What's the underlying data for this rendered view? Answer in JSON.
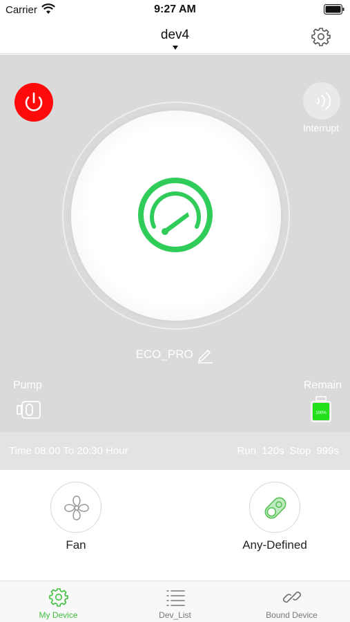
{
  "status_bar": {
    "carrier": "Carrier",
    "time": "9:27 AM"
  },
  "header": {
    "device_name": "dev4"
  },
  "controls": {
    "interrupt_label": "Interrupt"
  },
  "mode": {
    "name": "ECO_PRO"
  },
  "pump": {
    "label": "Pump"
  },
  "remain": {
    "label": "Remain",
    "level_text": "100%",
    "level_fraction": 1.0
  },
  "schedule": {
    "time_text": "Time 08:00 To 20:30 Hour",
    "run_label": "Run",
    "run_value": "120s",
    "stop_label": "Stop",
    "stop_value": "999s"
  },
  "features": [
    {
      "label": "Fan",
      "icon": "fan-icon"
    },
    {
      "label": "Any-Defined",
      "icon": "custom-toggle-icon"
    }
  ],
  "tabs": [
    {
      "label": "My Device",
      "icon": "gear-icon",
      "active": true
    },
    {
      "label": "Dev_List",
      "icon": "list-icon",
      "active": false
    },
    {
      "label": "Bound Device",
      "icon": "link-icon",
      "active": false
    }
  ],
  "colors": {
    "accent": "#3fbf3f",
    "power": "#ff0a0a",
    "panel": "#dadada"
  }
}
